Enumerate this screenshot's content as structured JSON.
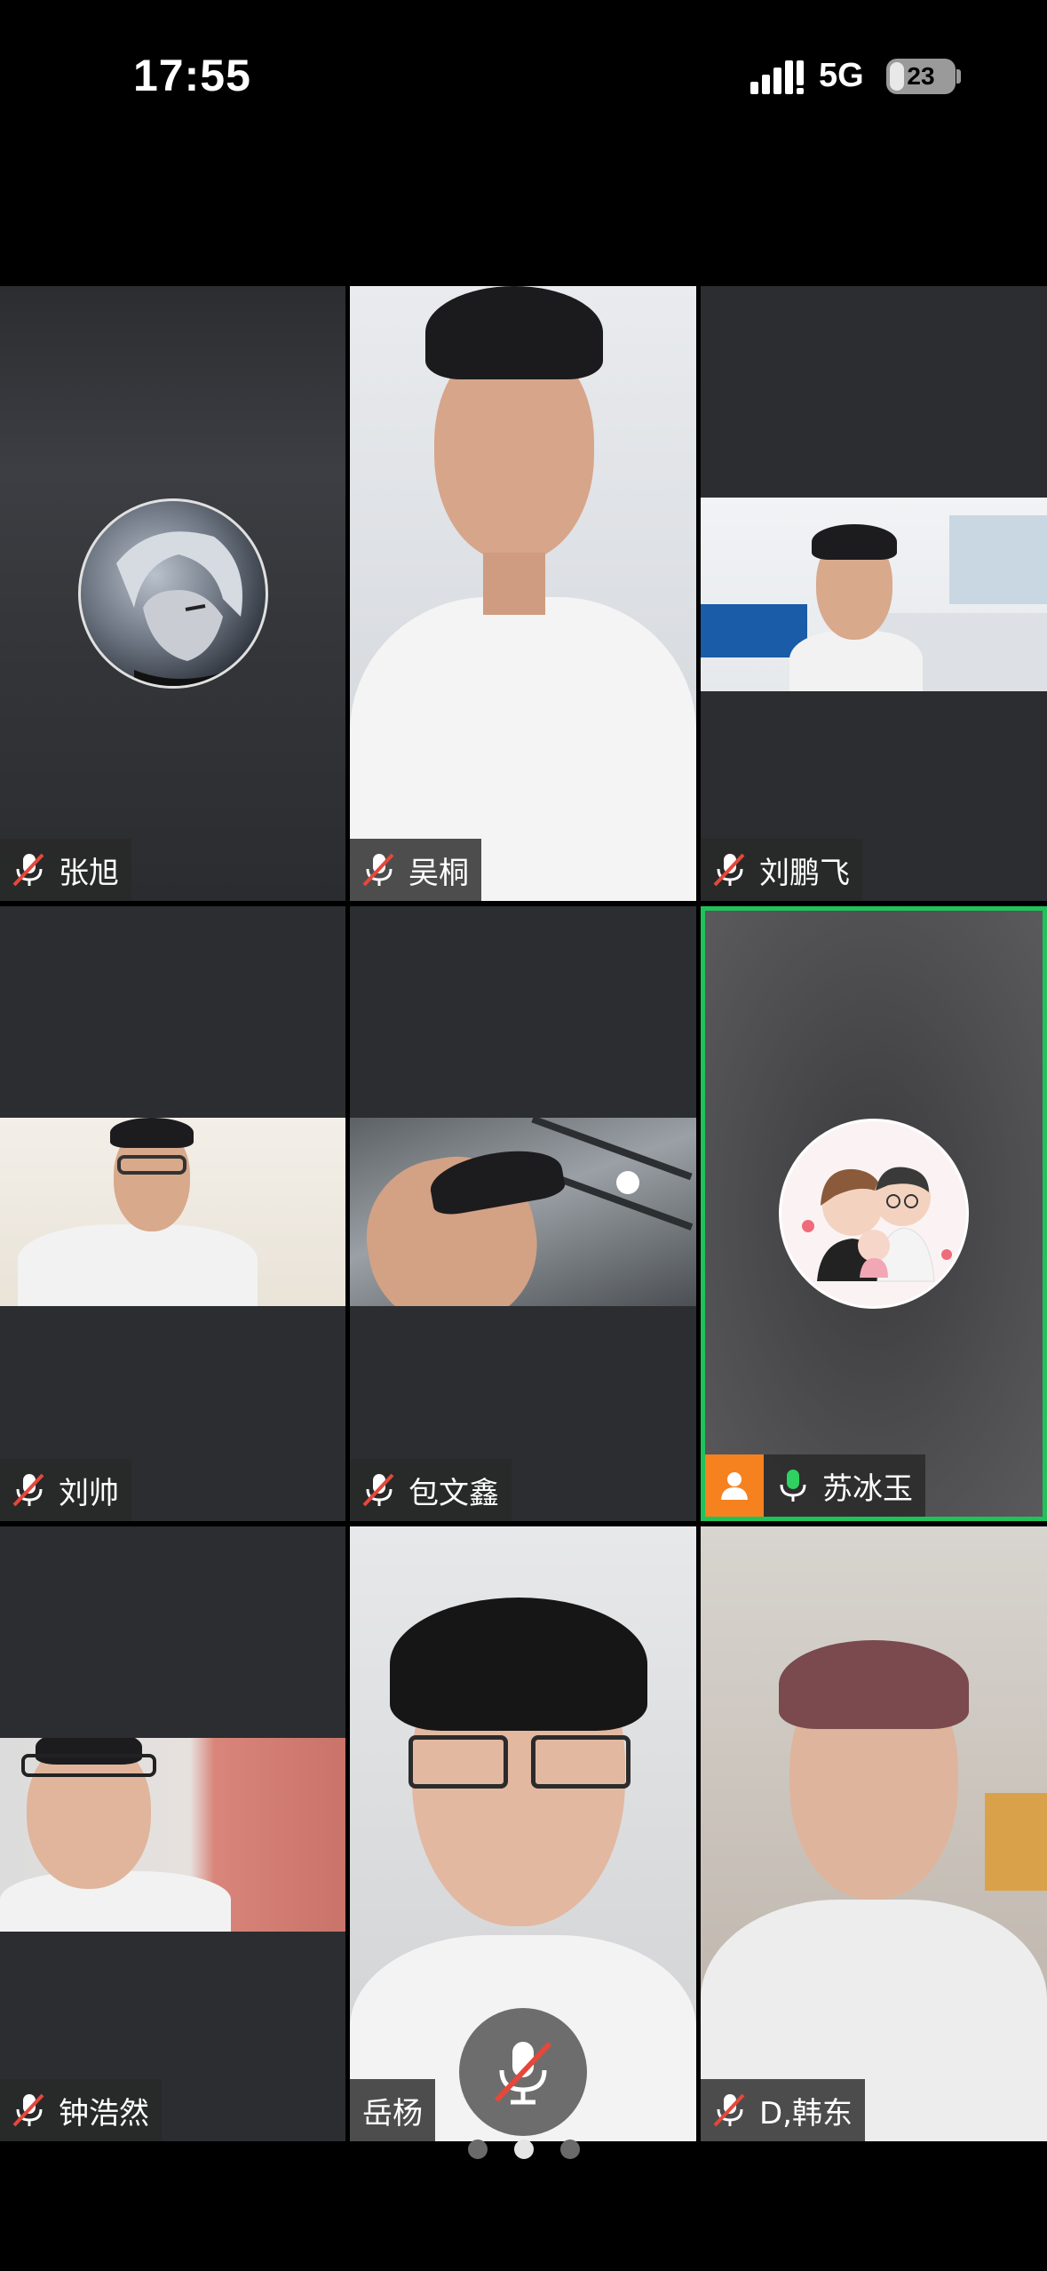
{
  "status_bar": {
    "time": "17:55",
    "network": "5G",
    "battery": "23",
    "battery_level_percent": 23,
    "signal_icon": "signal-bars-icon"
  },
  "participants": [
    {
      "name": "张旭",
      "muted": true,
      "video": false,
      "avatar": "anime-avatar"
    },
    {
      "name": "吴桐",
      "muted": true,
      "video": true
    },
    {
      "name": "刘鹏飞",
      "muted": true,
      "video": true
    },
    {
      "name": "刘帅",
      "muted": true,
      "video": true
    },
    {
      "name": "包文鑫",
      "muted": true,
      "video": true
    },
    {
      "name": "苏冰玉",
      "muted": false,
      "video": false,
      "avatar": "couple-avatar",
      "host": true,
      "active_speaker": true
    },
    {
      "name": "钟浩然",
      "muted": true,
      "video": true
    },
    {
      "name": "岳杨",
      "muted": false,
      "video": true
    },
    {
      "name": "D,韩东",
      "muted": true,
      "video": true
    }
  ],
  "colors": {
    "active_speaker_border": "#1fc35a",
    "host_badge": "#f5821f",
    "unmuted_mic": "#2fd160",
    "muted_slash": "#e5483b"
  },
  "pagination": {
    "pages": 3,
    "current": 2
  },
  "controls": {
    "floating_mic": "muted-microphone-icon"
  }
}
